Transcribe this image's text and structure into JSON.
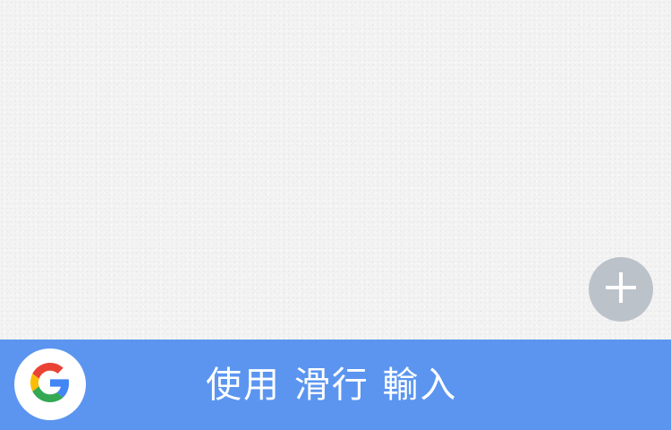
{
  "canvas": {
    "background_color": "#f3f3f3"
  },
  "fab": {
    "icon": "plus-icon",
    "color": "#bcc2ca"
  },
  "bottom_bar": {
    "color": "#5b95f0",
    "logo_icon": "google-g-icon",
    "label": "使用 滑行 輸入"
  }
}
